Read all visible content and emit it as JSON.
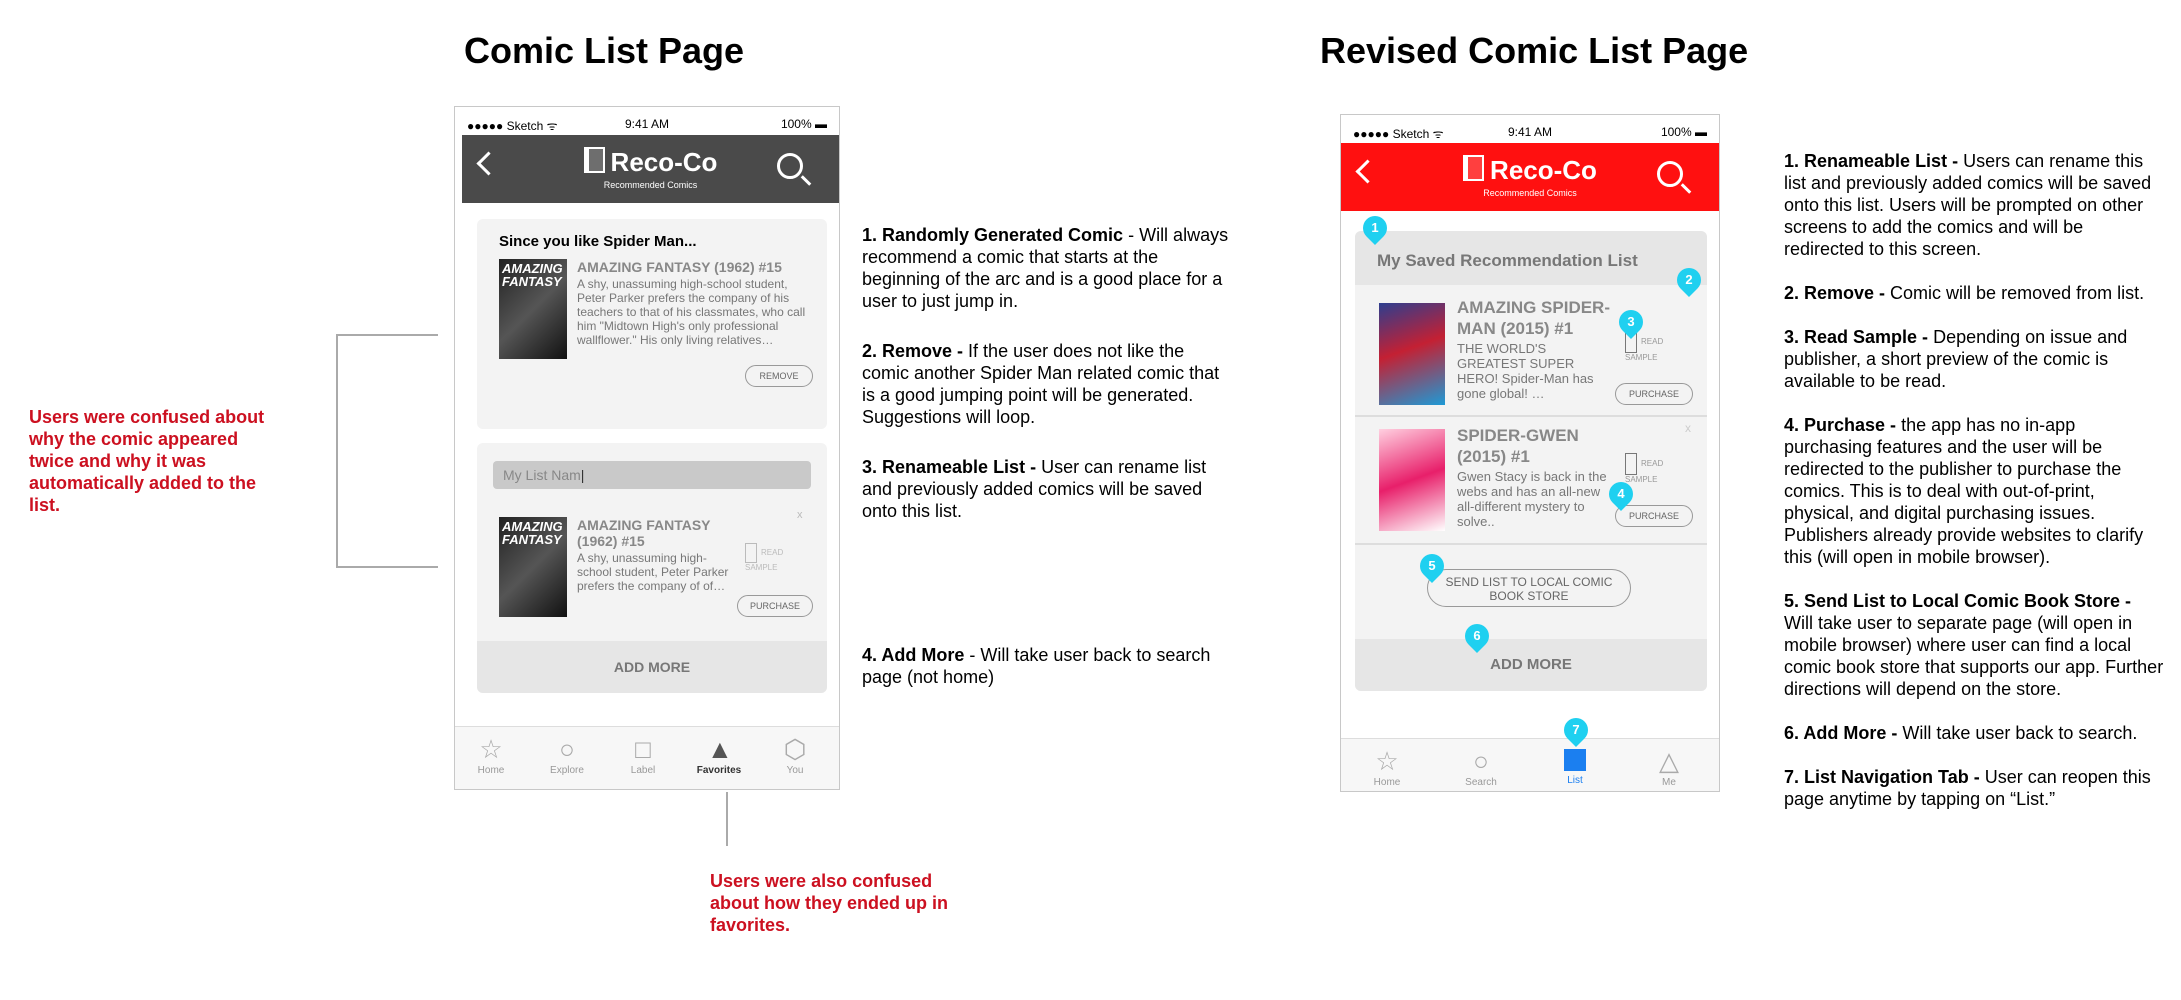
{
  "titles": {
    "left": "Comic List Page",
    "right": "Revised Comic List Page"
  },
  "status": {
    "carrier": "●●●●● Sketch ᯤ",
    "time": "9:41 AM",
    "battery": "100%"
  },
  "brand": {
    "name": "Reco-Co",
    "tagline": "Recommended Comics"
  },
  "colors": {
    "old_nav": "#4a4a4a",
    "new_nav": "#ff1010",
    "red_note": "#cc1020",
    "pin": "#1fd0f0",
    "tab_active_blue": "#1b7ff0"
  },
  "old": {
    "rec_heading": "Since you like Spider Man...",
    "rec_comic": {
      "cover_text": "AMAZING FANTASY",
      "title": "AMAZING FANTASY (1962) #15",
      "desc": "A shy, unassuming high-school student, Peter Parker prefers the company of his teachers to that of his classmates, who call him \"Midtown High's only professional wallflower.\" His only living relatives…",
      "remove": "REMOVE"
    },
    "list_name_value": "My List Nam",
    "list_item": {
      "cover_text": "AMAZING FANTASY",
      "title": "AMAZING FANTASY (1962) #15",
      "desc": "A shy, unassuming high-school student, Peter Parker prefers the company of of…",
      "close": "x",
      "read_sample": "READ SAMPLE",
      "purchase": "PURCHASE"
    },
    "add_more": "ADD MORE",
    "tabs": [
      "Home",
      "Explore",
      "Label",
      "Favorites",
      "You"
    ],
    "tab_icons": [
      "star-icon",
      "circle-icon",
      "square-icon",
      "triangle-icon",
      "hexagon-icon"
    ]
  },
  "new": {
    "list_title": "My Saved Recommendation List",
    "items": [
      {
        "title": "AMAZING SPIDER-MAN (2015) #1",
        "desc": "THE WORLD'S GREATEST SUPER HERO! Spider-Man has gone global! …",
        "read_sample": "READ SAMPLE",
        "purchase": "PURCHASE"
      },
      {
        "title": "SPIDER-GWEN (2015) #1",
        "desc": "Gwen Stacy is back in the webs and has an all-new all-different mystery to solve..",
        "read_sample": "READ SAMPLE",
        "purchase": "PURCHASE",
        "close": "x"
      }
    ],
    "send_list": "SEND LIST TO LOCAL COMIC BOOK STORE",
    "add_more": "ADD MORE",
    "tabs": [
      "Home",
      "Search",
      "List",
      "Me"
    ],
    "pins": [
      "1",
      "2",
      "3",
      "4",
      "5",
      "6",
      "7"
    ]
  },
  "old_notes": [
    {
      "bold": "1. Randomly Generated Comic",
      "text": " - Will always recommend a comic that starts at the beginning of the arc and is a good place for  a user to just jump in."
    },
    {
      "bold": "2. Remove -",
      "text": " If the user does not like the comic another Spider Man related comic that is a good jumping point will be generated. Suggestions will loop."
    },
    {
      "bold": "3. Renameable List -",
      "text": " User can rename list and previously added comics will be saved onto this list."
    },
    {
      "bold": "4. Add More",
      "text": " - Will take user back to search page (not home)"
    }
  ],
  "new_notes": [
    {
      "bold": "1. Renameable List -",
      "text": " Users can rename this list and previously added comics will be saved onto this list. Users will be prompted on other screens to add the comics and will be redirected to this screen."
    },
    {
      "bold": "2. Remove -",
      "text": " Comic will be removed from list."
    },
    {
      "bold": "3. Read Sample -",
      "text": " Depending on issue and publisher, a short preview of the comic is available to be read."
    },
    {
      "bold": "4. Purchase -",
      "text": " the app has no in-app purchasing features and the user will be redirected to the publisher to purchase the comics. This is to deal with out-of-print, physical, and digital purchasing issues. Publishers already provide websites to clarify this (will open in mobile browser)."
    },
    {
      "bold": "5. Send List to Local Comic Book Store -",
      "text": " Will take user to separate page (will open in mobile browser) where user can find a local comic book store that supports our app. Further directions will depend on the store."
    },
    {
      "bold": "6. Add More -",
      "text": " Will take user back to search."
    },
    {
      "bold": "7. List Navigation Tab -",
      "text": " User can reopen this page anytime by tapping on “List.”"
    }
  ],
  "red_notes": {
    "left": "Users were confused about why the comic appeared twice and why it was automatically added to the list.",
    "bottom": "Users were also confused about how they ended up in favorites."
  }
}
